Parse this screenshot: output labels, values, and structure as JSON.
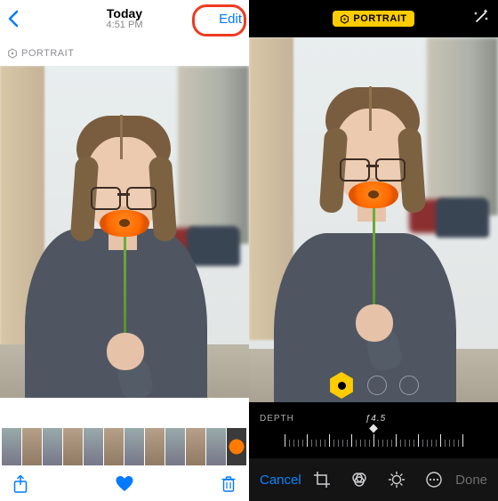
{
  "left": {
    "title": "Today",
    "subtitle": "4:51 PM",
    "edit_label": "Edit",
    "badge": "PORTRAIT",
    "bottom": {
      "share_icon": "share-icon",
      "favorite_icon": "heart-icon",
      "trash_icon": "trash-icon"
    }
  },
  "right": {
    "badge": "PORTRAIT",
    "depth_label": "DEPTH",
    "depth_value": "ƒ4.5",
    "cancel_label": "Cancel",
    "done_label": "Done",
    "tools": {
      "crop": "crop-icon",
      "filters": "filters-icon",
      "adjust": "adjust-icon",
      "more": "more-icon"
    }
  }
}
